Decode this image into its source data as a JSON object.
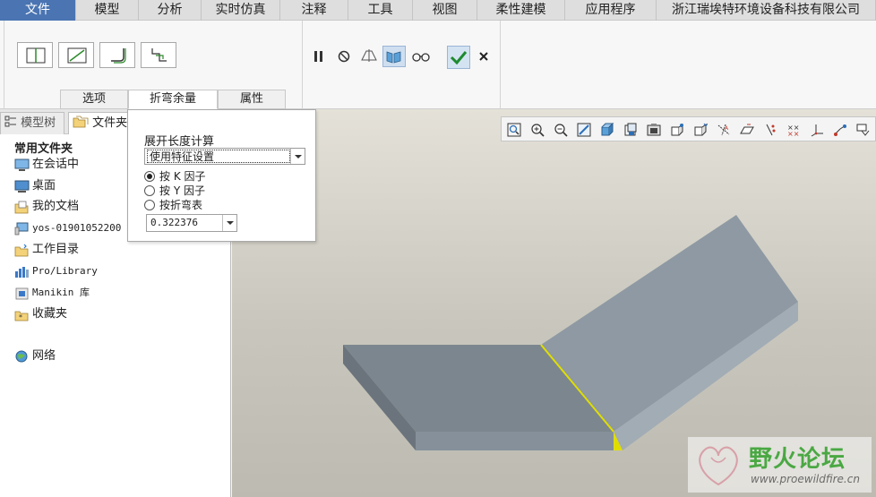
{
  "menubar": {
    "items": [
      "文件",
      "模型",
      "分析",
      "实时仿真",
      "注释",
      "工具",
      "视图",
      "柔性建模",
      "应用程序",
      "浙江瑞埃特环境设备科技有限公司"
    ],
    "active_index": 0
  },
  "ribbon": {
    "tabs": [
      "选项",
      "折弯余量",
      "属性"
    ],
    "active_tab": "折弯余量"
  },
  "left_panel": {
    "tabs": [
      "模型树",
      "文件夹浏览器"
    ],
    "section_title": "常用文件夹",
    "folders": [
      "在会话中",
      "桌面",
      "我的文档",
      "yos-01901052200",
      "工作目录",
      "Pro/Library",
      "Manikin 库",
      "收藏夹"
    ],
    "network": "网络"
  },
  "bend_panel": {
    "title": "展开长度计算",
    "method_value": "使用特征设置",
    "options": [
      "按 K 因子",
      "按 Y 因子",
      "按折弯表"
    ],
    "selected_option": 0,
    "k_factor": "0.322376"
  },
  "colors": {
    "accent": "#4a74b2",
    "model_top": "#7b858d",
    "model_flange": "#8d98a1",
    "bend_edge": "#e0de00"
  },
  "watermark": {
    "title": "野火论坛",
    "url": "www.proewildfire.cn"
  }
}
